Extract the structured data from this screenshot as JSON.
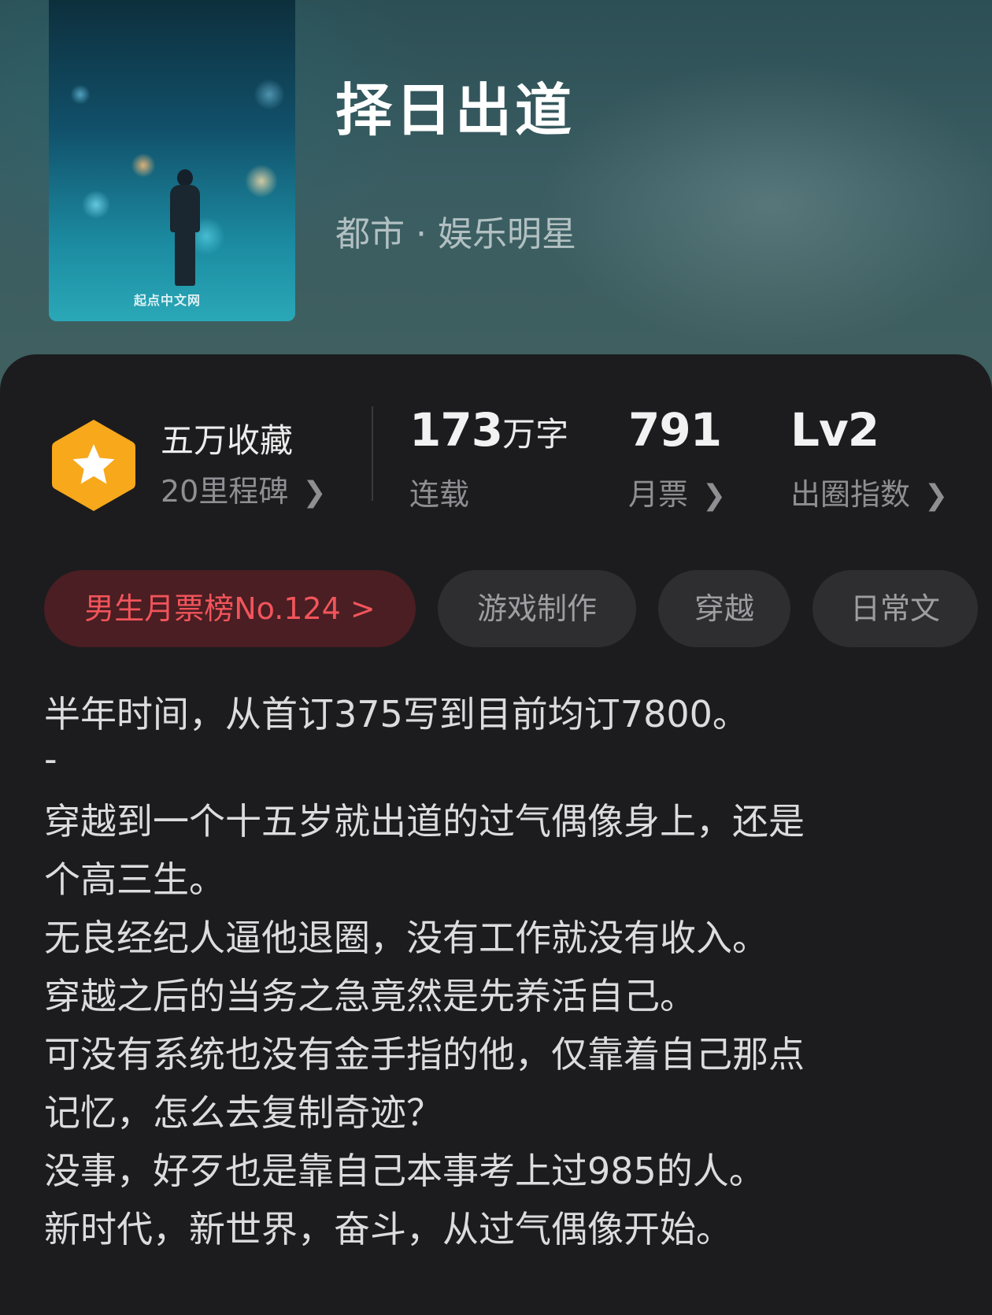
{
  "book": {
    "title": "择日出道",
    "category": "都市 · 娱乐明星",
    "cover_watermark": "起点中文网"
  },
  "stats": {
    "collection_title": "五万收藏",
    "collection_sub": "20里程碑",
    "word_count_number": "173",
    "word_count_unit": "万字",
    "status": "连载",
    "monthly_ticket_number": "791",
    "monthly_ticket_label": "月票",
    "level": "Lv2",
    "level_label": "出圈指数"
  },
  "tags": {
    "rank": "男生月票榜No.124 >",
    "items": [
      "游戏制作",
      "穿越",
      "日常文"
    ]
  },
  "description": {
    "lines": [
      "半年时间，从首订375写到目前均订7800。",
      "-",
      "穿越到一个十五岁就出道的过气偶像身上，还是",
      "个高三生。",
      "无良经纪人逼他退圈，没有工作就没有收入。",
      "穿越之后的当务之急竟然是先养活自己。",
      "可没有系统也没有金手指的他，仅靠着自己那点",
      "记忆，怎么去复制奇迹？",
      "没事，好歹也是靠自己本事考上过985的人。",
      "新时代，新世界，奋斗，从过气偶像开始。"
    ]
  },
  "colors": {
    "background": "#1c1c1e",
    "badge": "#f7a81b",
    "rank_tag_bg": "#4a1e22",
    "rank_tag_text": "#f2545b",
    "tag_bg": "#2e2e31"
  },
  "icons": {
    "badge": "star-badge-icon",
    "chevron": "chevron-right-icon"
  }
}
